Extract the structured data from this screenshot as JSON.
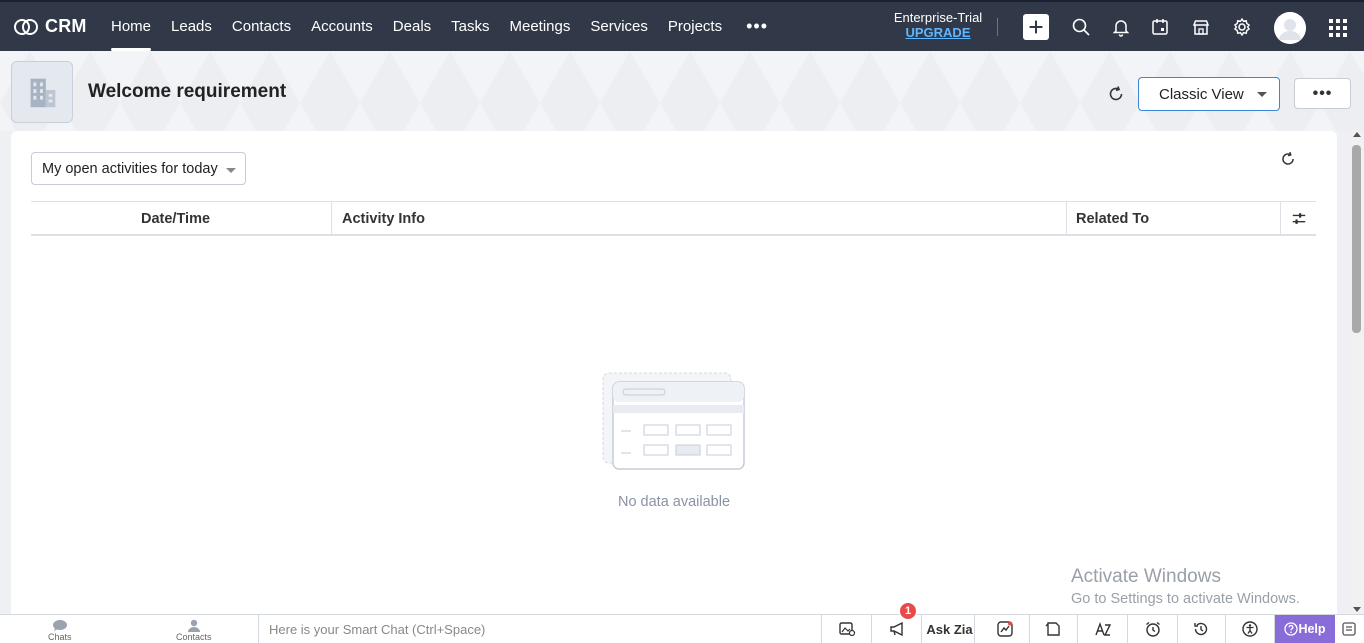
{
  "app": {
    "name": "CRM"
  },
  "nav": {
    "items": [
      {
        "label": "Home",
        "active": true
      },
      {
        "label": "Leads"
      },
      {
        "label": "Contacts"
      },
      {
        "label": "Accounts"
      },
      {
        "label": "Deals"
      },
      {
        "label": "Tasks"
      },
      {
        "label": "Meetings"
      },
      {
        "label": "Services"
      },
      {
        "label": "Projects"
      }
    ],
    "more_label": "•••"
  },
  "trial": {
    "plan": "Enterprise-Trial",
    "upgrade": "UPGRADE"
  },
  "header": {
    "title": "Welcome requirement",
    "view_button": "Classic View",
    "more_button": "•••"
  },
  "panel": {
    "filter_value": "My open activities for today",
    "columns": [
      "Date/Time",
      "Activity Info",
      "Related To"
    ],
    "empty_message": "No data available"
  },
  "watermark": {
    "line1": "Activate Windows",
    "line2": "Go to Settings to activate Windows."
  },
  "bottombar": {
    "chats_label": "Chats",
    "contacts_label": "Contacts",
    "chat_placeholder": "Here is your Smart Chat (Ctrl+Space)",
    "ask_zia": "Ask Zia",
    "notification_count": "1",
    "help_label": "Help"
  },
  "colors": {
    "topbar": "#313949",
    "accent": "#3b86d8",
    "upgrade": "#5fb6ff",
    "help": "#8a6cd8",
    "badge": "#e84a4a"
  }
}
